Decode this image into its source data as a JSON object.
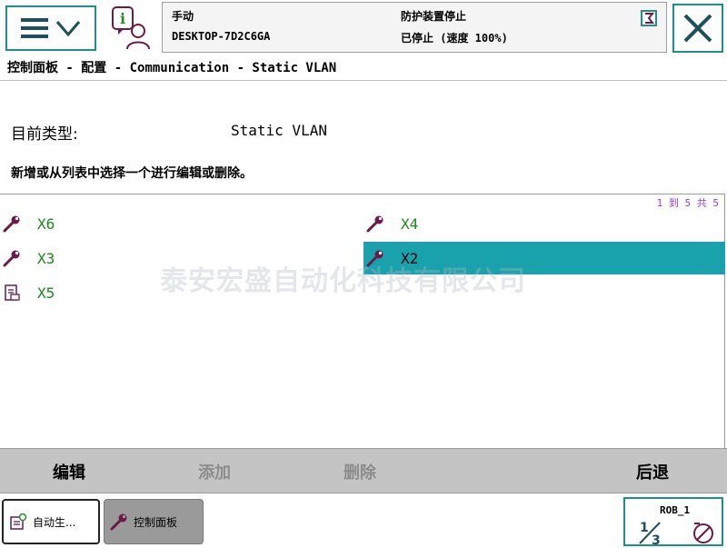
{
  "header": {
    "mode": "手动",
    "hostname": "DESKTOP-7D2C6GA",
    "guard_status": "防护装置停止",
    "run_state": "已停止 (速度 100%)"
  },
  "breadcrumb": "控制面板 - 配置 - Communication - Static VLAN",
  "content": {
    "type_label": "目前类型:",
    "type_value": "Static VLAN",
    "instruction": "新增或从列表中选择一个进行编辑或删除。"
  },
  "list": {
    "pager": "1 到 5 共 5",
    "items": [
      {
        "label": "X6",
        "icon": "wrench-icon",
        "selected": false
      },
      {
        "label": "X4",
        "icon": "wrench-icon",
        "selected": false
      },
      {
        "label": "X3",
        "icon": "wrench-icon",
        "selected": false
      },
      {
        "label": "X2",
        "icon": "wrench-icon",
        "selected": true
      },
      {
        "label": "X5",
        "icon": "config-file-icon",
        "selected": false
      }
    ]
  },
  "watermark": "泰安宏盛自动化科技有限公司",
  "actions": {
    "edit": "编辑",
    "add": "添加",
    "delete": "删除",
    "back": "后退"
  },
  "taskbar": {
    "apps": [
      {
        "label": "自动生...",
        "icon": "production-window-icon"
      },
      {
        "label": "控制面板",
        "icon": "wrench-icon"
      }
    ],
    "robot": {
      "name": "ROB_1",
      "fraction": "1/3"
    }
  },
  "colors": {
    "accent": "#1e8f8f",
    "selection": "#19a2ab",
    "item_text": "#1a8a1a",
    "pager_text": "#9a3bd6",
    "icon": "#6b1a4a",
    "action_bar": "#c4c4c4"
  }
}
